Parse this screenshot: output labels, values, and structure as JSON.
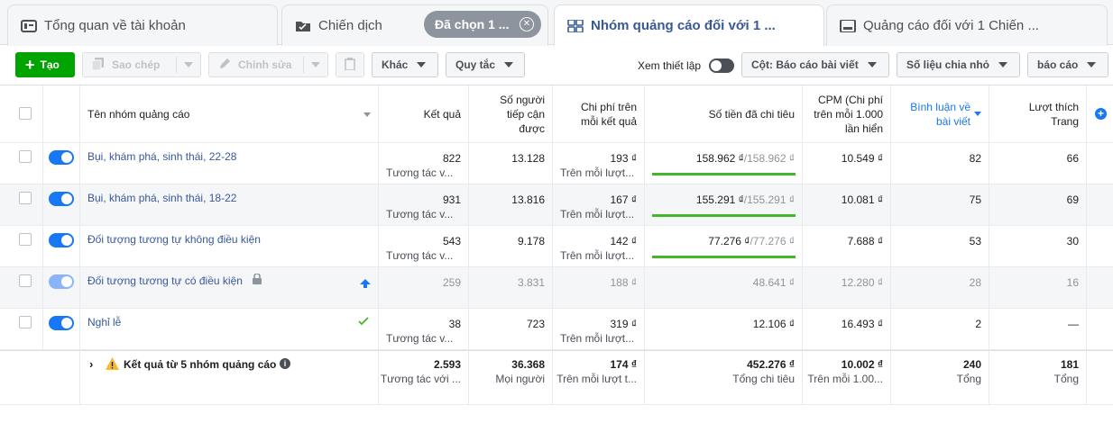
{
  "tabs": [
    {
      "label": "Tổng quan về tài khoản",
      "icon": "account-overview-icon"
    },
    {
      "label": "Chiến dịch",
      "icon": "campaign-folder-icon"
    },
    {
      "label": "Nhóm quảng cáo đối với 1 ...",
      "icon": "ad-set-grid-icon",
      "active": true
    },
    {
      "label": "Quảng cáo đối với 1 Chiến ...",
      "icon": "ad-icon"
    }
  ],
  "selected_pill": "Đã chọn 1 ...",
  "toolbar": {
    "create": "Tạo",
    "copy": "Sao chép",
    "edit": "Chỉnh sửa",
    "other": "Khác",
    "rules": "Quy tắc",
    "view_setup": "Xem thiết lập",
    "columns": "Cột: Báo cáo bài viết",
    "breakdown": "Số liệu chia nhỏ",
    "reports": "báo cáo"
  },
  "headers": {
    "name": "Tên nhóm quảng cáo",
    "results": "Kết quả",
    "reach": "Số người tiếp cận được",
    "cost_per": "Chi phí trên mỗi kết quả",
    "spent": "Số tiền đã chi tiêu",
    "cpm": "CPM (Chi phí trên mỗi 1.000 lần hiển",
    "comments": "Bình luận về bài viết",
    "likes": "Lượt thích Trang"
  },
  "rows": [
    {
      "name": "Bụi, khám phá, sinh thái, 22-28",
      "results": "822",
      "results_sub": "Tương tác v...",
      "reach": "13.128",
      "cost": "193 ₫",
      "cost_sub": "Trên mỗi lượt...",
      "spent": "158.962 ₫",
      "budget": "/158.962 ₫",
      "spent_pct": 1.0,
      "cpm": "10.549 ₫",
      "comments": "82",
      "likes": "66"
    },
    {
      "name": "Bụi, khám phá, sinh thái, 18-22",
      "results": "931",
      "results_sub": "Tương tác v...",
      "reach": "13.816",
      "cost": "167 ₫",
      "cost_sub": "Trên mỗi lượt...",
      "spent": "155.291 ₫",
      "budget": "/155.291 ₫",
      "spent_pct": 1.0,
      "cpm": "10.081 ₫",
      "comments": "75",
      "likes": "69"
    },
    {
      "name": "Đối tượng tương tự không điều kiện",
      "results": "543",
      "results_sub": "Tương tác v...",
      "reach": "9.178",
      "cost": "142 ₫",
      "cost_sub": "Trên mỗi lượt...",
      "spent": "77.276 ₫",
      "budget": "/77.276 ₫",
      "spent_pct": 1.0,
      "cpm": "7.688 ₫",
      "comments": "53",
      "likes": "30"
    },
    {
      "name": "Đối tượng tương tự có điều kiện",
      "results": "259",
      "results_sub": "",
      "reach": "3.831",
      "cost": "188 ₫",
      "cost_sub": "",
      "spent": "48.641 ₫",
      "budget": "",
      "spent_pct": 0,
      "cpm": "12.280 ₫",
      "comments": "28",
      "likes": "16"
    },
    {
      "name": "Nghỉ lễ",
      "results": "38",
      "results_sub": "Tương tác v...",
      "reach": "723",
      "cost": "319 ₫",
      "cost_sub": "Trên mỗi lượt...",
      "spent": "12.106 ₫",
      "budget": "",
      "spent_pct": 0,
      "cpm": "16.493 ₫",
      "comments": "2",
      "likes": "—"
    }
  ],
  "totals": {
    "label": "Kết quả từ 5 nhóm quảng cáo",
    "results": "2.593",
    "results_sub": "Tương tác với ...",
    "reach": "36.368",
    "reach_sub": "Mọi người",
    "cost": "174 ₫",
    "cost_sub": "Trên mỗi lượt t...",
    "spent": "452.276 ₫",
    "spent_sub": "Tổng chi tiêu",
    "cpm": "10.002 ₫",
    "cpm_sub": "Trên mỗi 1.00...",
    "comments": "240",
    "comments_sub": "Tổng",
    "likes": "181",
    "likes_sub": "Tổng"
  },
  "colors": {
    "accent": "#1877f2",
    "link": "#385898",
    "green": "#00a400",
    "bar": "#42b72a"
  }
}
